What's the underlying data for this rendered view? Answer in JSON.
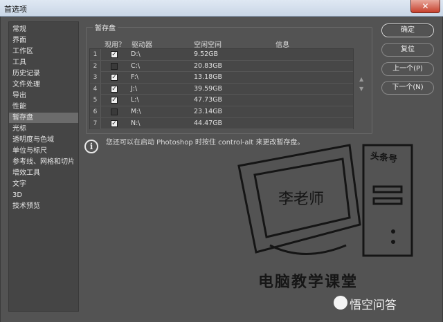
{
  "window": {
    "title": "首选项",
    "close_glyph": "✕"
  },
  "sidebar": {
    "items": [
      {
        "label": "常规"
      },
      {
        "label": "界面"
      },
      {
        "label": "工作区"
      },
      {
        "label": "工具"
      },
      {
        "label": "历史记录"
      },
      {
        "label": "文件处理"
      },
      {
        "label": "导出"
      },
      {
        "label": "性能"
      },
      {
        "label": "暂存盘",
        "active": true
      },
      {
        "label": "光标"
      },
      {
        "label": "透明度与色域"
      },
      {
        "label": "单位与标尺"
      },
      {
        "label": "参考线、网格和切片"
      },
      {
        "label": "增效工具"
      },
      {
        "label": "文字"
      },
      {
        "label": "3D"
      },
      {
        "label": "技术预览"
      }
    ]
  },
  "scratch": {
    "group_title": "暂存盘",
    "columns": {
      "active": "现用？",
      "drive": "驱动器",
      "space": "空闲空间",
      "info": "信息"
    },
    "rows": [
      {
        "num": "1",
        "checked": true,
        "drive": "D:\\",
        "space": "9.52GB",
        "info": ""
      },
      {
        "num": "2",
        "checked": false,
        "drive": "C:\\",
        "space": "20.83GB",
        "info": ""
      },
      {
        "num": "3",
        "checked": true,
        "drive": "F:\\",
        "space": "13.18GB",
        "info": ""
      },
      {
        "num": "4",
        "checked": true,
        "drive": "J:\\",
        "space": "39.59GB",
        "info": ""
      },
      {
        "num": "5",
        "checked": true,
        "drive": "L:\\",
        "space": "47.73GB",
        "info": ""
      },
      {
        "num": "6",
        "checked": false,
        "drive": "M:\\",
        "space": "23.14GB",
        "info": ""
      },
      {
        "num": "7",
        "checked": true,
        "drive": "N:\\",
        "space": "44.47GB",
        "info": ""
      }
    ],
    "note": "您还可以在启动 Photoshop 时按住 control-alt 来更改暂存盘。"
  },
  "buttons": {
    "ok": "确定",
    "reset": "复位",
    "prev": "上一个(P)",
    "next": "下一个(N)"
  },
  "watermark": {
    "screen_text": "李老师",
    "tower_text": "头条号",
    "caption": "电脑教学课堂",
    "brand": "悟空问答"
  },
  "icons": {
    "up_arrow": "▲",
    "down_arrow": "▼",
    "info": "i",
    "check": "✓"
  }
}
